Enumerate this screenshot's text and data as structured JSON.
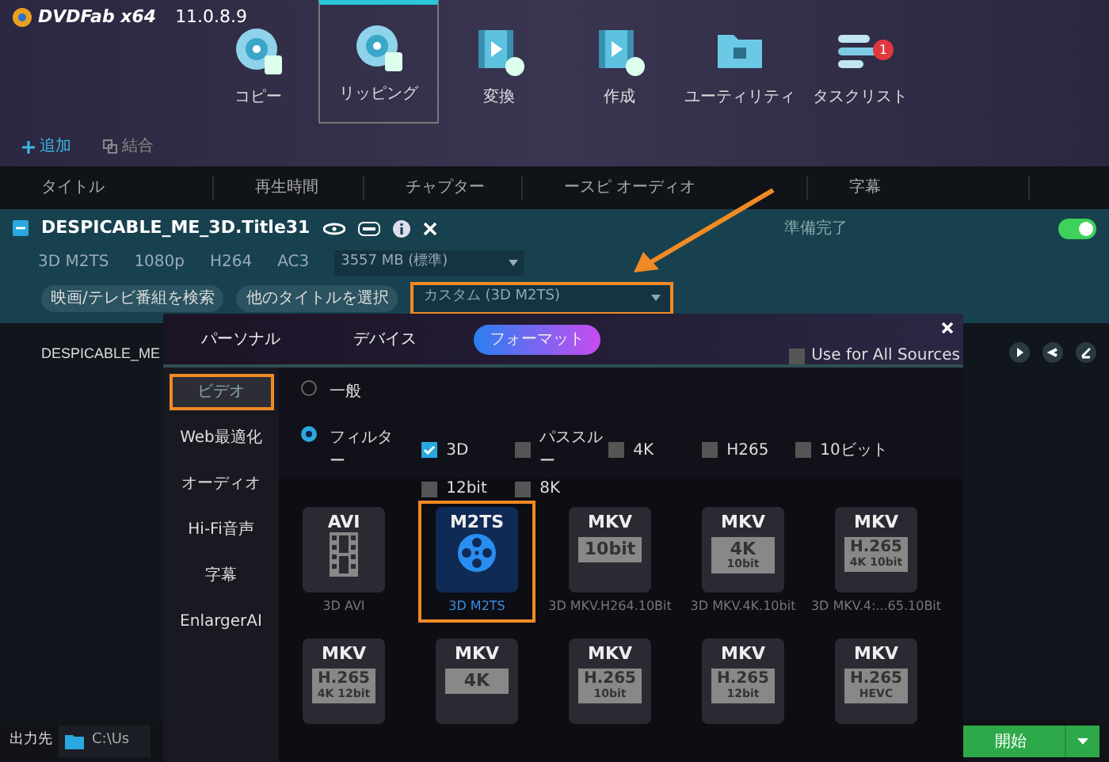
{
  "app": {
    "logo": "DVDFab",
    "arch": "x64",
    "version": "11.0.8.9"
  },
  "nav": [
    {
      "label": "コピー",
      "selected": false,
      "kind": "disc"
    },
    {
      "label": "リッピング",
      "selected": true,
      "kind": "disc"
    },
    {
      "label": "変換",
      "selected": false,
      "kind": "film"
    },
    {
      "label": "作成",
      "selected": false,
      "kind": "film"
    },
    {
      "label": "ユーティリティ",
      "selected": false,
      "kind": "folder"
    },
    {
      "label": "タスクリスト",
      "selected": false,
      "kind": "tasks",
      "badge": "1"
    }
  ],
  "actions": [
    {
      "label": "追加",
      "kind": "add",
      "disabled": false
    },
    {
      "label": "結合",
      "kind": "merge",
      "disabled": true
    }
  ],
  "columns": [
    "タイトル",
    "再生時間",
    "チャプター",
    "ースピ オーディオ",
    "字幕"
  ],
  "title_row": {
    "name": "DESPICABLE_ME_3D.Title31",
    "status": "準備完了",
    "enabled": true,
    "specs": [
      "3D M2TS",
      "1080p",
      "H264",
      "AC3"
    ],
    "size": "3557 MB (標準)",
    "buttons": [
      "映画/テレビ番組を検索",
      "他のタイトルを選択"
    ],
    "profile": "カスタム (3D M2TS)"
  },
  "second_row": {
    "name": "DESPICABLE_ME"
  },
  "dialog": {
    "tabs": [
      {
        "label": "パーソナル",
        "selected": false
      },
      {
        "label": "デバイス",
        "selected": false
      },
      {
        "label": "フォーマット",
        "selected": true
      }
    ],
    "use_all": {
      "label": "Use for All Sources",
      "checked": false
    },
    "sidebar": [
      {
        "label": "ビデオ",
        "selected": true
      },
      {
        "label": "Web最適化",
        "selected": false
      },
      {
        "label": "オーディオ",
        "selected": false
      },
      {
        "label": "Hi-Fi音声",
        "selected": false
      },
      {
        "label": "字幕",
        "selected": false
      },
      {
        "label": "EnlargerAI",
        "selected": false
      }
    ],
    "modes": [
      {
        "label": "一般",
        "selected": false
      },
      {
        "label": "フィルター",
        "selected": true
      }
    ],
    "filters": [
      {
        "label": "3D",
        "checked": true
      },
      {
        "label": "パススルー",
        "checked": false
      },
      {
        "label": "4K",
        "checked": false
      },
      {
        "label": "H265",
        "checked": false
      },
      {
        "label": "10ビット",
        "checked": false
      },
      {
        "label": "12bit",
        "checked": false
      },
      {
        "label": "8K",
        "checked": false
      }
    ],
    "tiles": [
      {
        "kind": "film",
        "top": "AVI",
        "caption": "3D AVI",
        "selected": false
      },
      {
        "kind": "reel",
        "top": "M2TS",
        "caption": "3D M2TS",
        "selected": true
      },
      {
        "kind": "box",
        "top": "MKV",
        "box": [
          "10bit"
        ],
        "caption": "3D MKV.H264.10Bit",
        "selected": false
      },
      {
        "kind": "box",
        "top": "MKV",
        "box": [
          "4K",
          "10bit"
        ],
        "caption": "3D MKV.4K.10bit",
        "selected": false
      },
      {
        "kind": "box",
        "top": "MKV",
        "box": [
          "H.265",
          "4K 10bit"
        ],
        "caption": "3D MKV.4:...65.10Bit",
        "selected": false
      },
      {
        "kind": "box",
        "top": "MKV",
        "box": [
          "H.265",
          "4K 12bit"
        ],
        "selected": false
      },
      {
        "kind": "box",
        "top": "MKV",
        "box": [
          "4K"
        ],
        "selected": false
      },
      {
        "kind": "box",
        "top": "MKV",
        "box": [
          "H.265",
          "10bit"
        ],
        "selected": false
      },
      {
        "kind": "box",
        "top": "MKV",
        "box": [
          "H.265",
          "12bit"
        ],
        "selected": false
      },
      {
        "kind": "box",
        "top": "MKV",
        "box": [
          "H.265",
          "HEVC"
        ],
        "selected": false
      }
    ]
  },
  "output": {
    "label": "出力先",
    "path": "C:\\Us"
  },
  "start": "開始"
}
